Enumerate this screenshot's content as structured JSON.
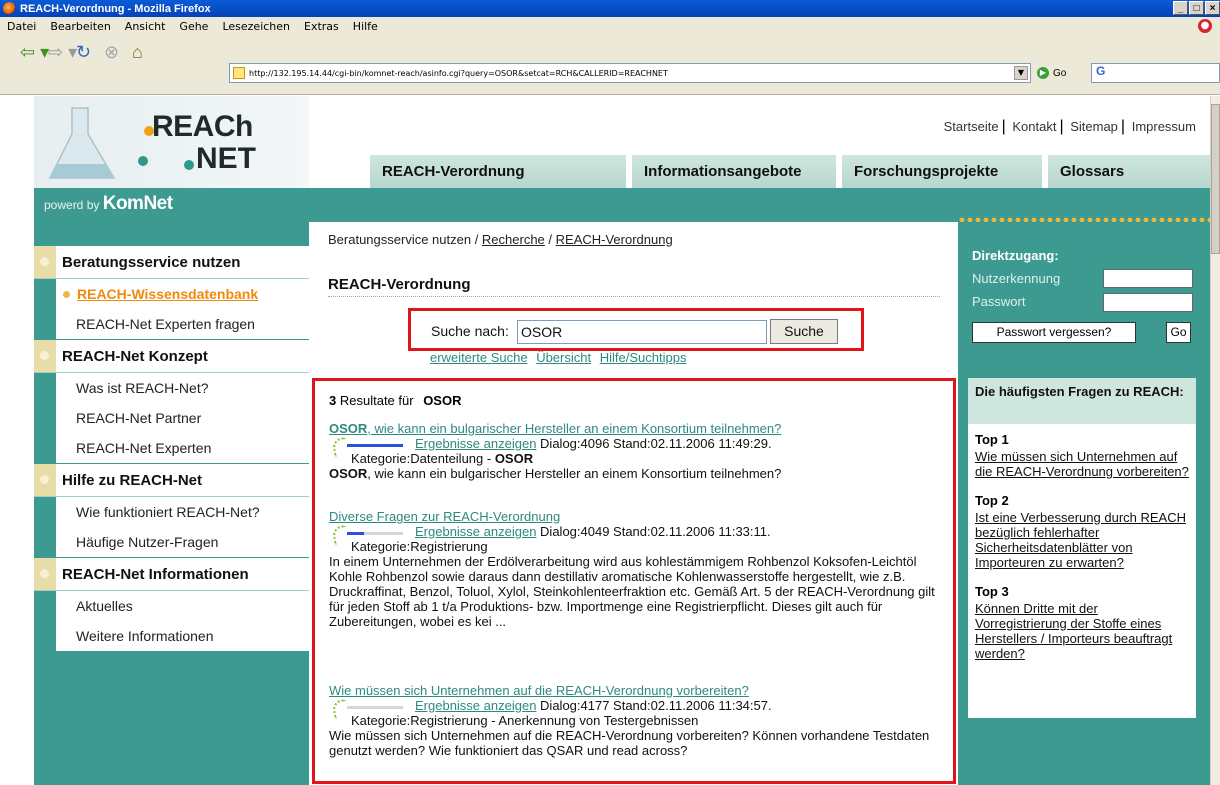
{
  "window": {
    "title": "REACH-Verordnung - Mozilla Firefox",
    "buttons": [
      "_",
      "□",
      "×"
    ]
  },
  "menu": [
    "Datei",
    "Bearbeiten",
    "Ansicht",
    "Gehe",
    "Lesezeichen",
    "Extras",
    "Hilfe"
  ],
  "toolbar": {
    "url": "http://132.195.14.44/cgi-bin/komnet-reach/asinfo.cgi?query=OSOR&setcat=RCH&CALLERID=REACHNET",
    "go_label": "Go",
    "search_value": "G"
  },
  "site": {
    "logo_top": "REACh",
    "logo_bottom": "NET",
    "powered_prefix": "powerd by",
    "powered_brand": "KomNet",
    "toplinks": [
      "Startseite",
      "Kontakt",
      "Sitemap",
      "Impressum"
    ],
    "tabs": [
      "REACH-Verordnung",
      "Informationsangebote",
      "Forschungsprojekte",
      "Glossars"
    ]
  },
  "leftnav": {
    "sections": [
      {
        "title": "Beratungsservice nutzen",
        "items": [
          "REACH-Wissensdatenbank",
          "REACH-Net Experten fragen"
        ]
      },
      {
        "title": "REACH-Net Konzept",
        "items": [
          "Was ist REACH-Net?",
          "REACH-Net Partner",
          "REACH-Net Experten"
        ]
      },
      {
        "title": "Hilfe zu REACH-Net",
        "items": [
          "Wie funktioniert REACH-Net?",
          "Häufige Nutzer-Fragen"
        ]
      },
      {
        "title": "REACH-Net Informationen",
        "items": [
          "Aktuelles",
          "Weitere Informationen"
        ]
      }
    ],
    "active_item": "REACH-Wissensdatenbank"
  },
  "main": {
    "breadcrumb": {
      "part1": "Beratungsservice nutzen / ",
      "link1": "Recherche",
      "sep": " / ",
      "link2": "REACH-Verordnung"
    },
    "title": "REACH-Verordnung",
    "search": {
      "label": "Suche nach:",
      "value": "OSOR",
      "button": "Suche"
    },
    "search_links": [
      "erweiterte Suche",
      "Übersicht",
      "Hilfe/Suchtipps"
    ],
    "results_count": "3",
    "results_label": "Resultate für",
    "results_query": "OSOR",
    "results": [
      {
        "title_bold": "OSOR",
        "title_rest": ", wie kann ein bulgarischer Hersteller an einem Konsortium teilnehmen?",
        "link": "Ergebnisse anzeigen",
        "meta": "Dialog:4096 Stand:02.11.2006 11:49:29.",
        "kategorie": "Kategorie:Datenteilung - ",
        "kategorie_bold": "OSOR",
        "snippet_bold": "OSOR",
        "snippet": ", wie kann ein bulgarischer Hersteller an einem Konsortium teilnehmen?",
        "relevance": 1.0
      },
      {
        "title_bold": "",
        "title_rest": "Diverse Fragen zur REACH-Verordnung",
        "link": "Ergebnisse anzeigen",
        "meta": "Dialog:4049 Stand:02.11.2006 11:33:11.",
        "kategorie": "Kategorie:Registrierung",
        "kategorie_bold": "",
        "snippet_bold": "",
        "snippet": "In einem Unternehmen der Erdölverarbeitung wird aus kohlestämmigem Rohbenzol Koksofen-Leichtöl Kohle Rohbenzol sowie daraus dann destillativ aromatische Kohlenwasserstoffe hergestellt, wie z.B. Druckraffinat, Benzol, Toluol, Xylol, Steinkohlenteerfraktion etc. Gemäß Art. 5 der REACH-Verordnung gilt für jeden Stoff ab 1 t/a Produktions- bzw. Importmenge eine Registrierpflicht. Dieses gilt auch für Zubereitungen, wobei es kei ...",
        "relevance": 0.3
      },
      {
        "title_bold": "",
        "title_rest": "Wie müssen sich Unternehmen auf die REACH-Verordnung vorbereiten?",
        "link": "Ergebnisse anzeigen",
        "meta": "Dialog:4177 Stand:02.11.2006 11:34:57.",
        "kategorie": "Kategorie:Registrierung - Anerkennung von Testergebnissen",
        "kategorie_bold": "",
        "snippet_bold": "",
        "snippet": "Wie müssen sich Unternehmen auf die REACH-Verordnung vorbereiten? Können vorhandene Testdaten genutzt werden? Wie funktioniert das QSAR und read across?",
        "relevance": 0.0
      }
    ]
  },
  "right": {
    "direktzugang": "Direktzugang:",
    "user_label": "Nutzerkennung",
    "pass_label": "Passwort",
    "forgot": "Passwort vergessen?",
    "go": "Go",
    "faq_head": "Die häufigsten Fragen zu REACH:",
    "faq": [
      {
        "label": "Top 1",
        "text": "Wie müssen sich Unternehmen auf die REACH-Verordnung vorbereiten?"
      },
      {
        "label": "Top 2",
        "text": "Ist eine Verbesserung durch REACH bezüglich fehlerhafter Sicherheitsdatenblätter von Importeuren zu erwarten?"
      },
      {
        "label": "Top 3",
        "text": "Können Dritte mit der Vorregistrierung der Stoffe eines Herstellers / Importeurs beauftragt werden?"
      }
    ]
  }
}
